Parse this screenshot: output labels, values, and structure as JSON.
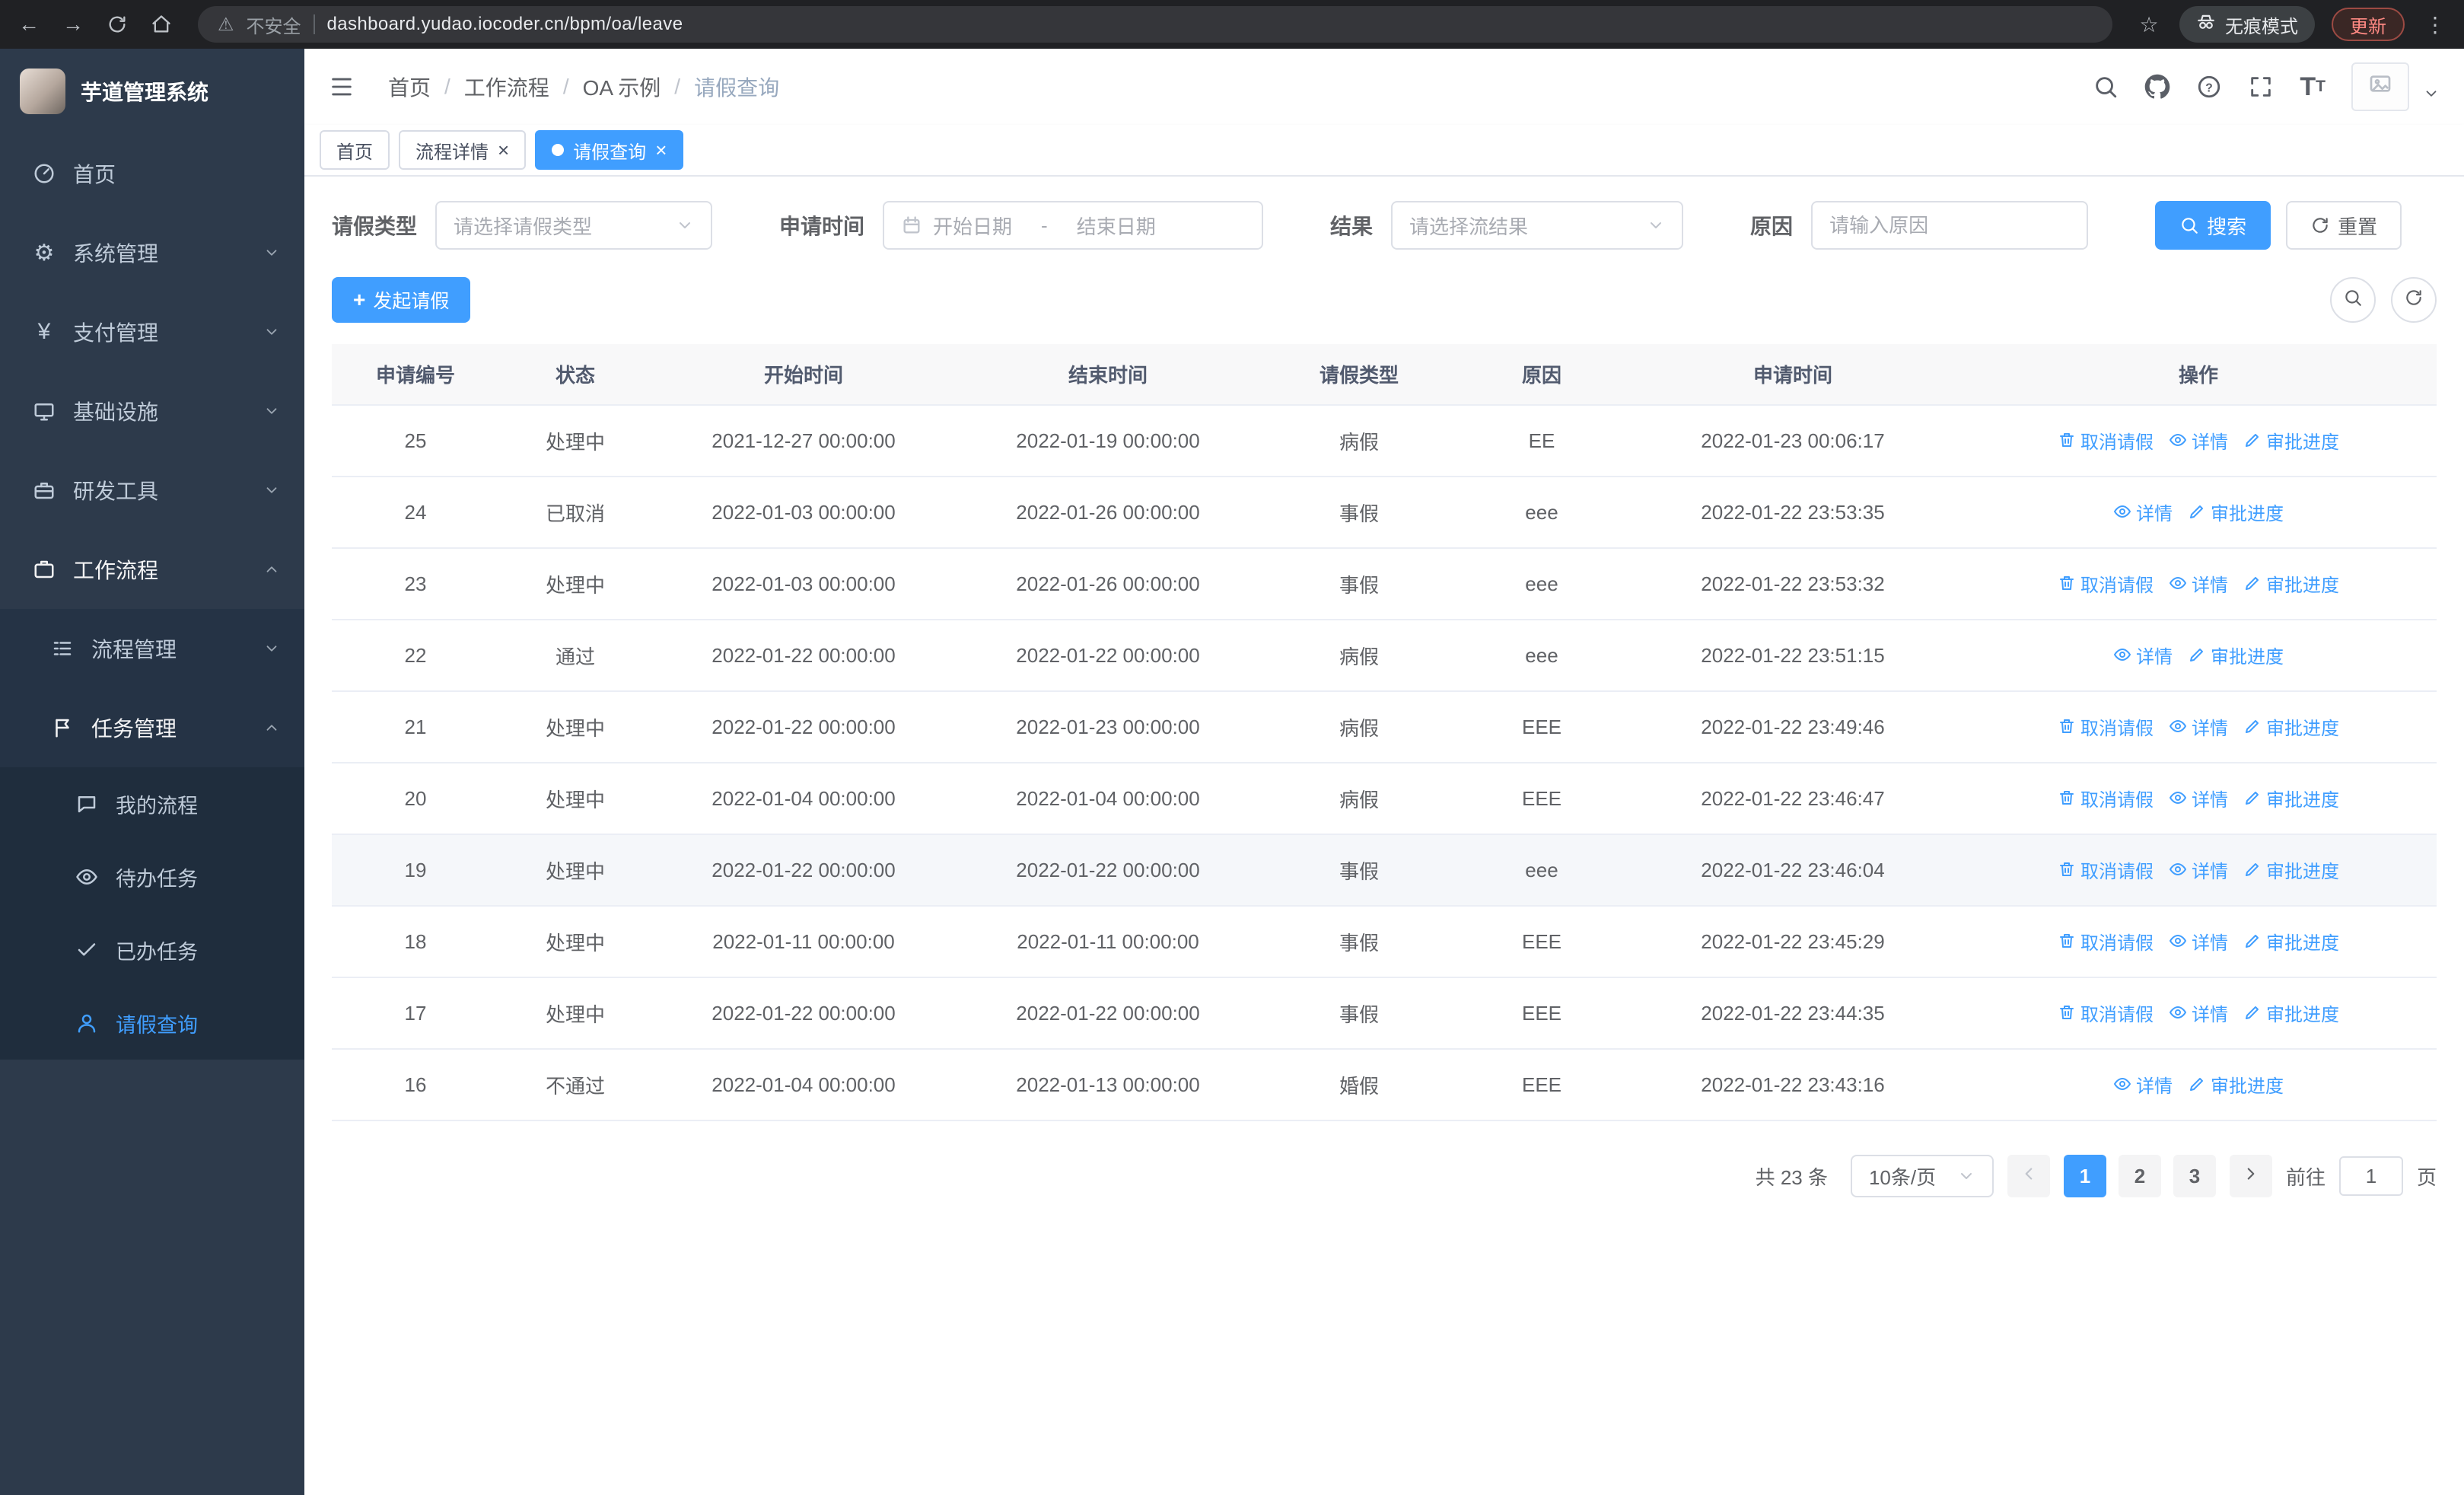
{
  "chrome": {
    "security_label": "不安全",
    "url": "dashboard.yudao.iocoder.cn/bpm/oa/leave",
    "incognito_label": "无痕模式",
    "update_label": "更新"
  },
  "sidebar": {
    "logo_text": "芋道管理系统",
    "menu": [
      {
        "label": "首页",
        "icon": "dashboard-icon",
        "level": 0,
        "arrow": null,
        "active": false,
        "open": false
      },
      {
        "label": "系统管理",
        "icon": "gear-icon",
        "level": 0,
        "arrow": "down",
        "active": false,
        "open": false
      },
      {
        "label": "支付管理",
        "icon": "yen-icon",
        "level": 0,
        "arrow": "down",
        "active": false,
        "open": false
      },
      {
        "label": "基础设施",
        "icon": "monitor-icon",
        "level": 0,
        "arrow": "down",
        "active": false,
        "open": false
      },
      {
        "label": "研发工具",
        "icon": "briefcase-icon",
        "level": 0,
        "arrow": "down",
        "active": false,
        "open": false
      },
      {
        "label": "工作流程",
        "icon": "workflow-icon",
        "level": 0,
        "arrow": "up",
        "active": false,
        "open": true
      },
      {
        "label": "流程管理",
        "icon": "list-icon",
        "level": 1,
        "arrow": "down",
        "active": false,
        "open": false
      },
      {
        "label": "任务管理",
        "icon": "flag-icon",
        "level": 1,
        "arrow": "up",
        "active": false,
        "open": true
      },
      {
        "label": "我的流程",
        "icon": "chat-icon",
        "level": 2,
        "arrow": null,
        "active": false,
        "open": false
      },
      {
        "label": "待办任务",
        "icon": "eye-icon",
        "level": 2,
        "arrow": null,
        "active": false,
        "open": false
      },
      {
        "label": "已办任务",
        "icon": "check-icon",
        "level": 2,
        "arrow": null,
        "active": false,
        "open": false
      },
      {
        "label": "请假查询",
        "icon": "user-icon",
        "level": 2,
        "arrow": null,
        "active": true,
        "open": false
      }
    ]
  },
  "header": {
    "breadcrumb": [
      "首页",
      "工作流程",
      "OA 示例",
      "请假查询"
    ]
  },
  "tabs": [
    {
      "label": "首页",
      "closable": false,
      "active": false
    },
    {
      "label": "流程详情",
      "closable": true,
      "active": false
    },
    {
      "label": "请假查询",
      "closable": true,
      "active": true
    }
  ],
  "filters": {
    "leave_type_label": "请假类型",
    "leave_type_placeholder": "请选择请假类型",
    "apply_time_label": "申请时间",
    "start_date_placeholder": "开始日期",
    "range_separator": "-",
    "end_date_placeholder": "结束日期",
    "result_label": "结果",
    "result_placeholder": "请选择流结果",
    "reason_label": "原因",
    "reason_placeholder": "请输入原因",
    "search_label": "搜索",
    "reset_label": "重置"
  },
  "toolbar": {
    "create_label": "发起请假"
  },
  "table": {
    "columns": [
      "申请编号",
      "状态",
      "开始时间",
      "结束时间",
      "请假类型",
      "原因",
      "申请时间",
      "操作"
    ],
    "action_labels": {
      "cancel": "取消请假",
      "detail": "详情",
      "progress": "审批进度"
    },
    "rows": [
      {
        "id": "25",
        "status": "处理中",
        "start_time": "2021-12-27 00:00:00",
        "end_time": "2022-01-19 00:00:00",
        "leave_type": "病假",
        "reason": "EE",
        "apply_time": "2022-01-23 00:06:17",
        "actions": [
          "cancel",
          "detail",
          "progress"
        ],
        "hover": false
      },
      {
        "id": "24",
        "status": "已取消",
        "start_time": "2022-01-03 00:00:00",
        "end_time": "2022-01-26 00:00:00",
        "leave_type": "事假",
        "reason": "eee",
        "apply_time": "2022-01-22 23:53:35",
        "actions": [
          "detail",
          "progress"
        ],
        "hover": false
      },
      {
        "id": "23",
        "status": "处理中",
        "start_time": "2022-01-03 00:00:00",
        "end_time": "2022-01-26 00:00:00",
        "leave_type": "事假",
        "reason": "eee",
        "apply_time": "2022-01-22 23:53:32",
        "actions": [
          "cancel",
          "detail",
          "progress"
        ],
        "hover": false
      },
      {
        "id": "22",
        "status": "通过",
        "start_time": "2022-01-22 00:00:00",
        "end_time": "2022-01-22 00:00:00",
        "leave_type": "病假",
        "reason": "eee",
        "apply_time": "2022-01-22 23:51:15",
        "actions": [
          "detail",
          "progress"
        ],
        "hover": false
      },
      {
        "id": "21",
        "status": "处理中",
        "start_time": "2022-01-22 00:00:00",
        "end_time": "2022-01-23 00:00:00",
        "leave_type": "病假",
        "reason": "EEE",
        "apply_time": "2022-01-22 23:49:46",
        "actions": [
          "cancel",
          "detail",
          "progress"
        ],
        "hover": false
      },
      {
        "id": "20",
        "status": "处理中",
        "start_time": "2022-01-04 00:00:00",
        "end_time": "2022-01-04 00:00:00",
        "leave_type": "病假",
        "reason": "EEE",
        "apply_time": "2022-01-22 23:46:47",
        "actions": [
          "cancel",
          "detail",
          "progress"
        ],
        "hover": false
      },
      {
        "id": "19",
        "status": "处理中",
        "start_time": "2022-01-22 00:00:00",
        "end_time": "2022-01-22 00:00:00",
        "leave_type": "事假",
        "reason": "eee",
        "apply_time": "2022-01-22 23:46:04",
        "actions": [
          "cancel",
          "detail",
          "progress"
        ],
        "hover": true
      },
      {
        "id": "18",
        "status": "处理中",
        "start_time": "2022-01-11 00:00:00",
        "end_time": "2022-01-11 00:00:00",
        "leave_type": "事假",
        "reason": "EEE",
        "apply_time": "2022-01-22 23:45:29",
        "actions": [
          "cancel",
          "detail",
          "progress"
        ],
        "hover": false
      },
      {
        "id": "17",
        "status": "处理中",
        "start_time": "2022-01-22 00:00:00",
        "end_time": "2022-01-22 00:00:00",
        "leave_type": "事假",
        "reason": "EEE",
        "apply_time": "2022-01-22 23:44:35",
        "actions": [
          "cancel",
          "detail",
          "progress"
        ],
        "hover": false
      },
      {
        "id": "16",
        "status": "不通过",
        "start_time": "2022-01-04 00:00:00",
        "end_time": "2022-01-13 00:00:00",
        "leave_type": "婚假",
        "reason": "EEE",
        "apply_time": "2022-01-22 23:43:16",
        "actions": [
          "detail",
          "progress"
        ],
        "hover": false
      }
    ]
  },
  "pagination": {
    "total_text": "共 23 条",
    "page_size_label": "10条/页",
    "pages": [
      "1",
      "2",
      "3"
    ],
    "active_page": "1",
    "goto_label": "前往",
    "goto_value": "1",
    "goto_suffix": "页"
  },
  "colors": {
    "primary": "#409eff",
    "sidebar_bg": "#2d3a4b",
    "sidebar_sub_bg": "#1f2d3d",
    "chrome_bg": "#202124",
    "table_header_bg": "#f8f8f9"
  }
}
